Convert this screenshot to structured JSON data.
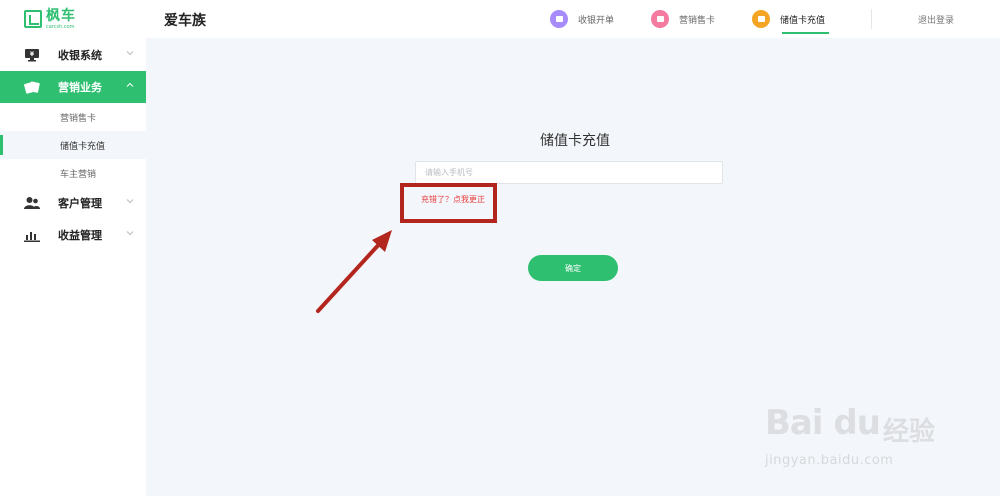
{
  "logo": {
    "name": "枫车",
    "sub": "carcsh.com"
  },
  "sidebar": {
    "items": [
      {
        "label": "收银系统",
        "icon": "monitor-icon"
      },
      {
        "label": "营销业务",
        "icon": "cards-icon",
        "active": true,
        "children": [
          {
            "label": "营销售卡"
          },
          {
            "label": "储值卡充值",
            "active": true
          },
          {
            "label": "车主营销"
          }
        ]
      },
      {
        "label": "客户管理",
        "icon": "users-icon"
      },
      {
        "label": "收益管理",
        "icon": "bar-chart-icon"
      }
    ]
  },
  "header": {
    "brand": "爱车族",
    "nav": [
      {
        "label": "收银开单",
        "color": "#a78bfa"
      },
      {
        "label": "营销售卡",
        "color": "#f47aa0"
      },
      {
        "label": "储值卡充值",
        "color": "#f5a524",
        "active": true
      }
    ],
    "logout": "退出登录"
  },
  "main": {
    "title": "储值卡充值",
    "phone_placeholder": "请输入手机号",
    "correct_link": "充错了？点我更正",
    "confirm": "确定"
  },
  "watermark": {
    "main": "Bai du",
    "cn": "经验",
    "url": "jingyan.baidu.com"
  },
  "colors": {
    "accent": "#2fbf71",
    "annotation": "#b3261e",
    "link": "#e83e3e"
  }
}
